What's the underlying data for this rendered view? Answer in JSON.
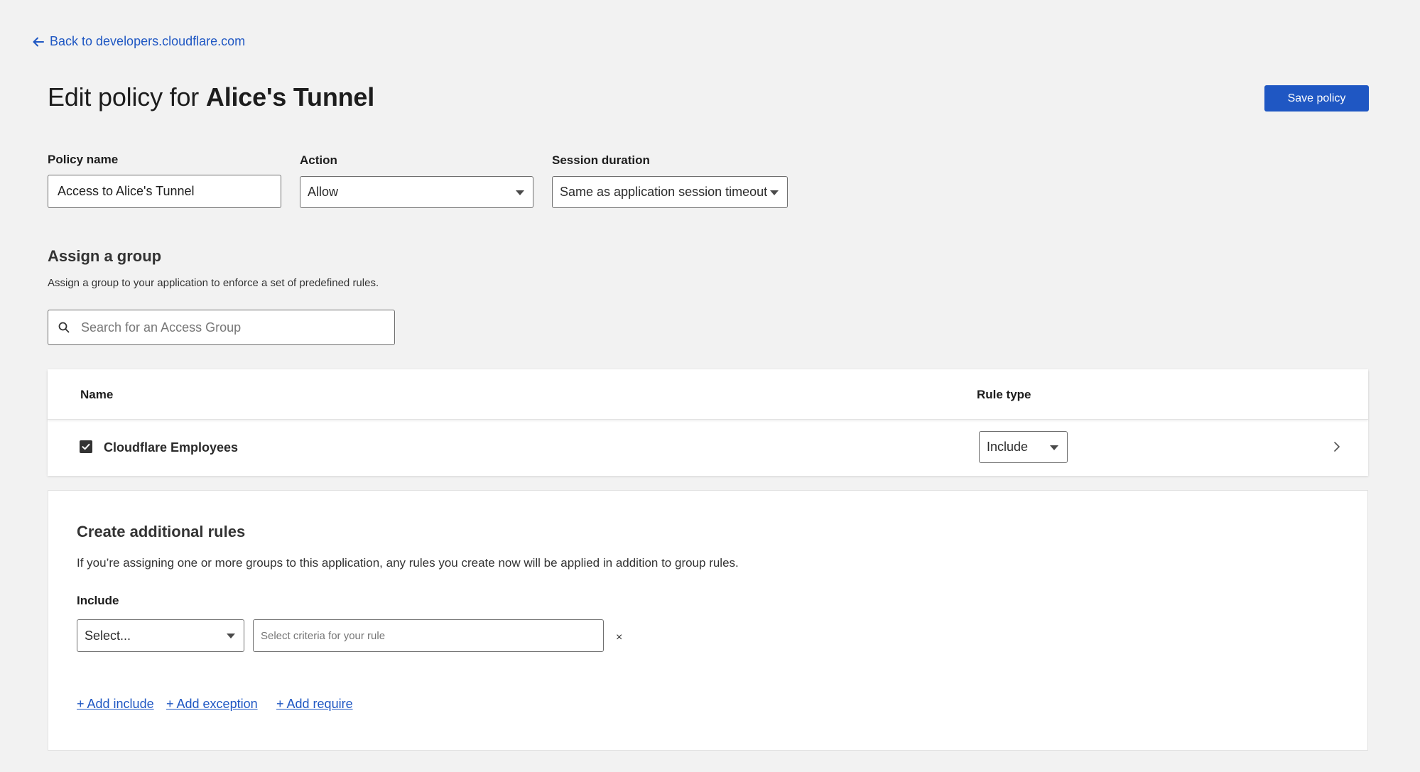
{
  "back_link": {
    "label": "Back to developers.cloudflare.com"
  },
  "header": {
    "title_prefix": "Edit policy for",
    "title_app": "Alice's Tunnel",
    "save_label": "Save policy"
  },
  "form": {
    "policy_name": {
      "label": "Policy name",
      "value": "Access to Alice's Tunnel"
    },
    "action": {
      "label": "Action",
      "value": "Allow"
    },
    "session_duration": {
      "label": "Session duration",
      "value": "Same as application session timeout"
    }
  },
  "assign_group": {
    "heading": "Assign a group",
    "description": "Assign a group to your application to enforce a set of predefined rules.",
    "search_placeholder": "Search for an Access Group"
  },
  "groups_table": {
    "columns": [
      "Name",
      "Rule type"
    ],
    "rows": [
      {
        "name": "Cloudflare Employees",
        "checked": true,
        "rule_type": "Include"
      }
    ]
  },
  "additional_rules": {
    "heading": "Create additional rules",
    "description": "If you’re assigning one or more groups to this application, any rules you create now will be applied in addition to group rules.",
    "include_label": "Include",
    "selector_value": "Select...",
    "criteria_placeholder": "Select criteria for your rule",
    "remove_symbol": "×",
    "links": [
      "+ Add include",
      "+ Add exception",
      "+ Add require"
    ]
  },
  "colors": {
    "accent": "#1f57c3",
    "background": "#f2f2f2",
    "text": "#1d1d1d"
  }
}
